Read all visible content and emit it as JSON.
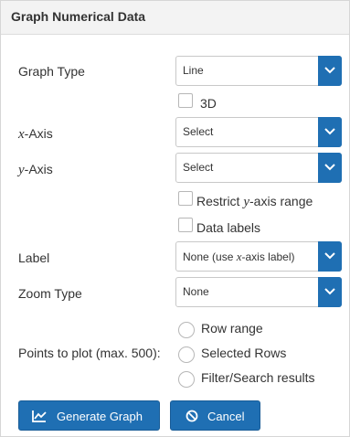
{
  "title": "Graph Numerical Data",
  "graph_type": {
    "label": "Graph Type",
    "value": "Line"
  },
  "three_d": {
    "label": "3D",
    "checked": false
  },
  "x_axis": {
    "label_var": "x",
    "label_suffix": "-Axis",
    "value": "Select"
  },
  "y_axis": {
    "label_var": "y",
    "label_suffix": "-Axis",
    "value": "Select"
  },
  "restrict_y": {
    "label_pre": "Restrict ",
    "label_var": "y",
    "label_post": "-axis range",
    "checked": false
  },
  "data_labels": {
    "label": "Data labels",
    "checked": false
  },
  "label_field": {
    "label": "Label",
    "value_pre": "None (use ",
    "value_var": "x",
    "value_post": "-axis label)"
  },
  "zoom_type": {
    "label": "Zoom Type",
    "value": "None"
  },
  "points": {
    "label": "Points to plot (max. 500):",
    "options": [
      "Row range",
      "Selected Rows",
      "Filter/Search results"
    ]
  },
  "buttons": {
    "generate": "Generate Graph",
    "cancel": "Cancel"
  },
  "colors": {
    "primary": "#1f6fb3",
    "title_bg": "#f3f3f3"
  },
  "icons": {
    "dropdown": "chevron-down-icon",
    "generate": "line-chart-icon",
    "cancel": "ban-icon"
  }
}
